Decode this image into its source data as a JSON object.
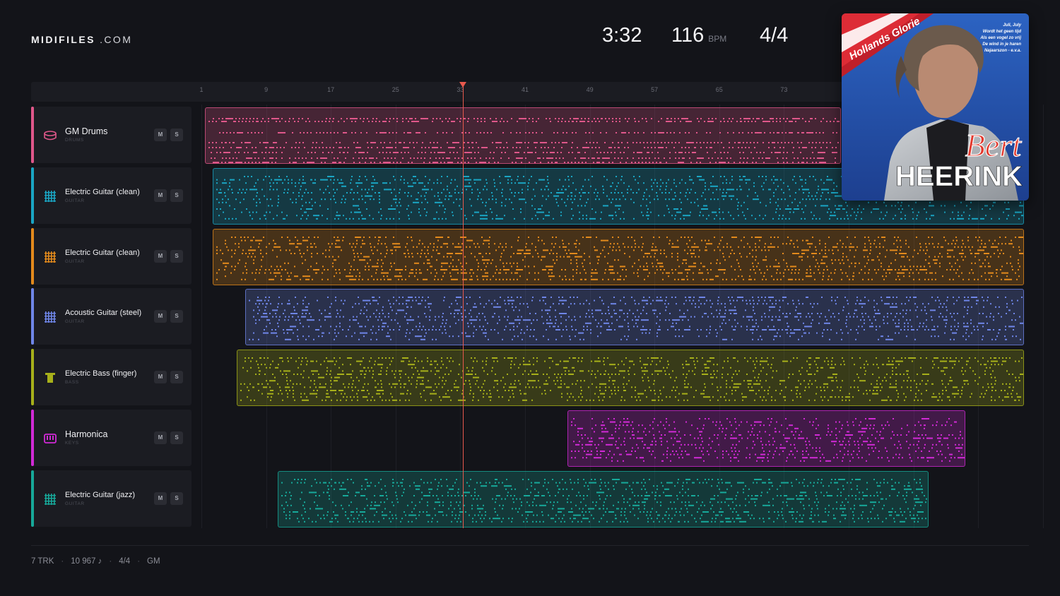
{
  "brand": {
    "bold": "MIDIFILES",
    "light": ".COM"
  },
  "transport": {
    "time": "3:32",
    "tempo": "116",
    "tempo_unit": "BPM",
    "meter": "4/4"
  },
  "ruler": {
    "ticks": [
      "1",
      "9",
      "17",
      "25",
      "33",
      "41",
      "49",
      "57",
      "65",
      "73"
    ]
  },
  "playhead_bar": 33,
  "tracks": [
    {
      "name": "GM Drums",
      "category": "DRUMS",
      "color": "#e0578a",
      "icon": "drum-icon",
      "mute": "M",
      "solo": "S"
    },
    {
      "name": "Electric Guitar (clean)",
      "category": "GUITAR",
      "color": "#1aa6c4",
      "icon": "guitar-fretboard-icon",
      "mute": "M",
      "solo": "S"
    },
    {
      "name": "Electric Guitar (clean)",
      "category": "GUITAR",
      "color": "#e38a1c",
      "icon": "guitar-fretboard-icon",
      "mute": "M",
      "solo": "S"
    },
    {
      "name": "Acoustic Guitar (steel)",
      "category": "GUITAR",
      "color": "#6f86e8",
      "icon": "guitar-fretboard-icon",
      "mute": "M",
      "solo": "S"
    },
    {
      "name": "Electric Bass (finger)",
      "category": "BASS",
      "color": "#a7b01a",
      "icon": "bass-icon",
      "mute": "M",
      "solo": "S"
    },
    {
      "name": "Harmonica",
      "category": "KEYS",
      "color": "#d12ad6",
      "icon": "keys-icon",
      "mute": "M",
      "solo": "S"
    },
    {
      "name": "Electric Guitar (jazz)",
      "category": "GUITAR",
      "color": "#17a99a",
      "icon": "guitar-fretboard-icon",
      "mute": "M",
      "solo": "S"
    }
  ],
  "album": {
    "series": "Hollands Glorie",
    "artist_first": "Bert",
    "artist_last": "HEERINK",
    "songs": [
      "Juli, July",
      "Wordt het geen tijd",
      "Als een vogel zo vrij",
      "De wind in je haren",
      "Najaarszon - e.v.a."
    ]
  },
  "footer": {
    "tracks": "7 TRK",
    "notes": "10 967 ♪",
    "meter": "4/4",
    "standard": "GM"
  }
}
